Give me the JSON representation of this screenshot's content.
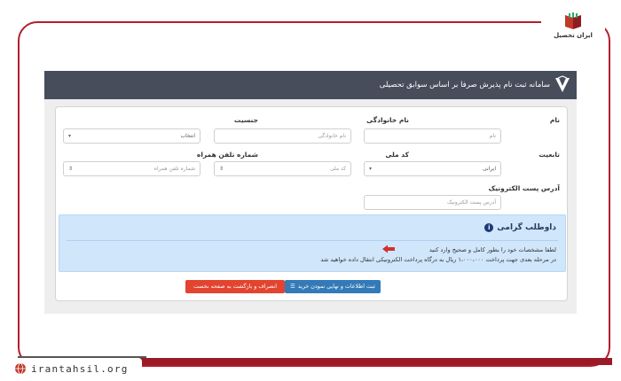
{
  "brand": {
    "logo_text": "ایران تحصیل",
    "site_url": "irantahsil.org"
  },
  "titlebar": {
    "title": "سامانه ثبت نام پذیرش صرفا بر اساس سوابق تحصیلی"
  },
  "form": {
    "row1": {
      "name": {
        "label": "نام",
        "placeholder": "نام"
      },
      "family": {
        "label": "نام خانوادگی",
        "placeholder": "نام خانوادگی"
      },
      "gender": {
        "label": "جنسیت",
        "value": "انتخاب"
      }
    },
    "row2": {
      "nationality": {
        "label": "تابعیت",
        "value": "ایرانی"
      },
      "national_code": {
        "label": "کد ملی",
        "placeholder": "کد ملی"
      },
      "mobile": {
        "label": "شماره تلفن همراه",
        "placeholder": "شماره تلفن همراه"
      }
    },
    "row3": {
      "email": {
        "label": "آدرس پست الکترونیک",
        "placeholder": "آدرس پست الکترونیک"
      }
    }
  },
  "notice": {
    "title": "داوطلب گرامی",
    "line1": "لطفا مشخصات خود را بطور کامل و صحیح وارد کنید",
    "line2": "در مرحله بعدی جهت پرداخت ۱،۰۰۰،۰۰۰ ریال به درگاه پرداخت الکترونیکی انتقال داده خواهید شد"
  },
  "buttons": {
    "submit": "ثبت اطلاعات و نهایی نمودن خرید",
    "cancel": "انصراف و بازگشت به صفحه نخست"
  },
  "colors": {
    "titlebar": "#474d5b",
    "notice_bg": "#cfe6fb",
    "btn_primary": "#337ab7",
    "btn_danger": "#e2442f",
    "frame_accent": "#b21f2d"
  }
}
